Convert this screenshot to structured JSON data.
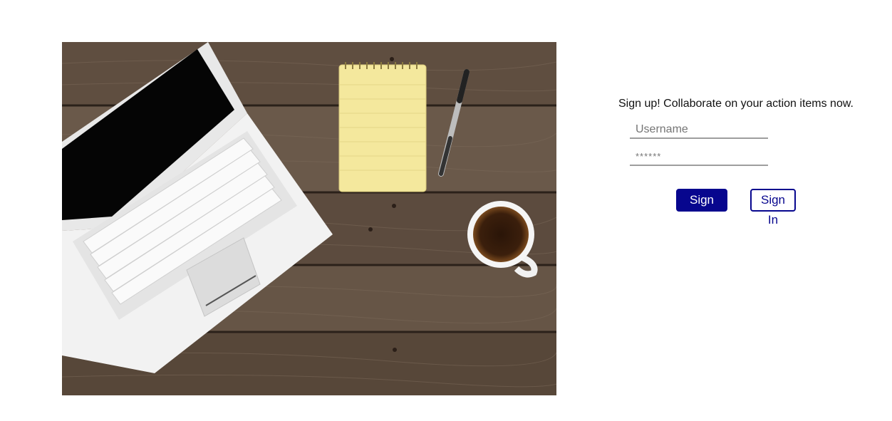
{
  "hero": {
    "alt": "Laptop, notepad, pen and coffee on a wooden desk"
  },
  "signup": {
    "tagline": "Sign up! Collaborate on your action items now.",
    "username_placeholder": "Username",
    "password_placeholder": "******",
    "signup_label": "Sign Up",
    "signin_label": "Sign In"
  },
  "colors": {
    "primary": "#07068e",
    "underline": "#9e9e9e"
  }
}
